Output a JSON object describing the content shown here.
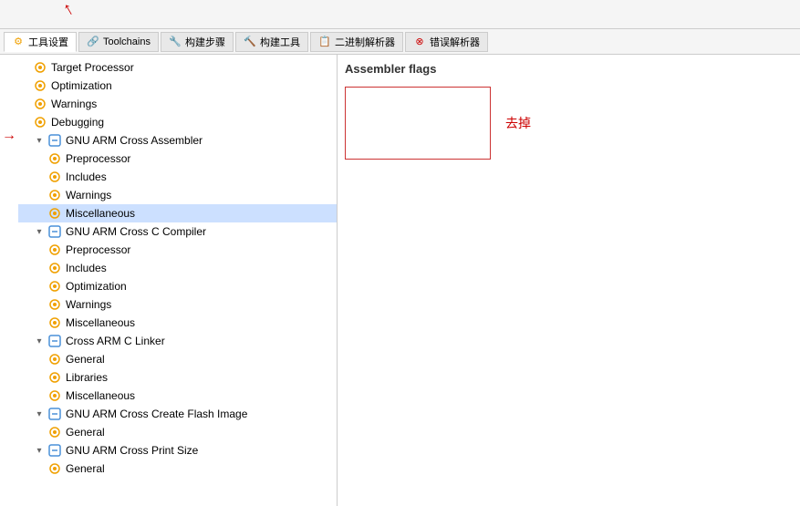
{
  "toolbar": {
    "tabs": [
      {
        "id": "tools",
        "label": "工具设置",
        "icon": "gear",
        "active": true
      },
      {
        "id": "toolchains",
        "label": "Toolchains",
        "icon": "chain"
      },
      {
        "id": "build-steps",
        "label": "构建步骤",
        "icon": "wrench"
      },
      {
        "id": "build-tools",
        "label": "构建工具",
        "icon": "tool"
      },
      {
        "id": "binary-parser",
        "label": "二进制解析器",
        "icon": "binary"
      },
      {
        "id": "error-parser",
        "label": "错误解析器",
        "icon": "error"
      }
    ]
  },
  "tree": {
    "items": [
      {
        "id": "target-processor",
        "label": "Target Processor",
        "level": 1,
        "type": "leaf",
        "selected": false
      },
      {
        "id": "optimization",
        "label": "Optimization",
        "level": 1,
        "type": "leaf",
        "selected": false
      },
      {
        "id": "warnings",
        "label": "Warnings",
        "level": 1,
        "type": "leaf",
        "selected": false
      },
      {
        "id": "debugging",
        "label": "Debugging",
        "level": 1,
        "type": "leaf",
        "selected": false
      },
      {
        "id": "gnu-arm-assembler",
        "label": "GNU ARM Cross Assembler",
        "level": 1,
        "type": "parent",
        "expanded": true
      },
      {
        "id": "asm-preprocessor",
        "label": "Preprocessor",
        "level": 2,
        "type": "leaf",
        "selected": false
      },
      {
        "id": "asm-includes",
        "label": "Includes",
        "level": 2,
        "type": "leaf",
        "selected": false
      },
      {
        "id": "asm-warnings",
        "label": "Warnings",
        "level": 2,
        "type": "leaf",
        "selected": false,
        "arrow": true
      },
      {
        "id": "asm-miscellaneous",
        "label": "Miscellaneous",
        "level": 2,
        "type": "leaf",
        "selected": true
      },
      {
        "id": "gnu-arm-c-compiler",
        "label": "GNU ARM Cross C Compiler",
        "level": 1,
        "type": "parent",
        "expanded": true
      },
      {
        "id": "cc-preprocessor",
        "label": "Preprocessor",
        "level": 2,
        "type": "leaf",
        "selected": false
      },
      {
        "id": "cc-includes",
        "label": "Includes",
        "level": 2,
        "type": "leaf",
        "selected": false
      },
      {
        "id": "cc-optimization",
        "label": "Optimization",
        "level": 2,
        "type": "leaf",
        "selected": false
      },
      {
        "id": "cc-warnings",
        "label": "Warnings",
        "level": 2,
        "type": "leaf",
        "selected": false
      },
      {
        "id": "cc-miscellaneous",
        "label": "Miscellaneous",
        "level": 2,
        "type": "leaf",
        "selected": false
      },
      {
        "id": "cross-arm-linker",
        "label": "Cross ARM C Linker",
        "level": 1,
        "type": "parent",
        "expanded": true
      },
      {
        "id": "linker-general",
        "label": "General",
        "level": 2,
        "type": "leaf",
        "selected": false
      },
      {
        "id": "linker-libraries",
        "label": "Libraries",
        "level": 2,
        "type": "leaf",
        "selected": false
      },
      {
        "id": "linker-miscellaneous",
        "label": "Miscellaneous",
        "level": 2,
        "type": "leaf",
        "selected": false
      },
      {
        "id": "gnu-arm-flash",
        "label": "GNU ARM Cross Create Flash Image",
        "level": 1,
        "type": "parent",
        "expanded": true
      },
      {
        "id": "flash-general",
        "label": "General",
        "level": 2,
        "type": "leaf",
        "selected": false
      },
      {
        "id": "gnu-arm-print-size",
        "label": "GNU ARM Cross Print Size",
        "level": 1,
        "type": "parent",
        "expanded": true
      },
      {
        "id": "print-general",
        "label": "General",
        "level": 2,
        "type": "leaf",
        "selected": false
      }
    ]
  },
  "content": {
    "header": "Assembler flags",
    "remove_label": "去掉",
    "textarea_placeholder": ""
  },
  "annotations": {
    "top_arrow": "↑",
    "left_arrow": "→"
  }
}
